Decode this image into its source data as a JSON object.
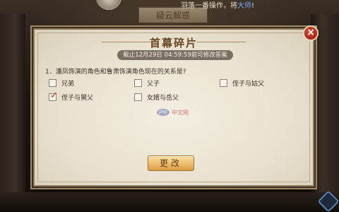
{
  "background": {
    "top_tab_label": "疑云解惑",
    "notice_prefix": "羽落一番操作，将大师",
    "notice_highlight": "大师",
    "notice_suffix": "!"
  },
  "dialog": {
    "title": "首幕碎片",
    "deadline": "截止12月29日 04:59:59前可修改答案",
    "close_icon": "×",
    "question": "1．潘凤饰演的角色和鲁肃饰演角色现在的关系是?",
    "options": [
      {
        "label": "兄弟",
        "checked": false
      },
      {
        "label": "父子",
        "checked": false
      },
      {
        "label": "侄子与姑父",
        "checked": false
      },
      {
        "label": "侄子与舅父",
        "checked": true
      },
      {
        "label": "女婿与岳父",
        "checked": false
      }
    ],
    "submit_label": "更改"
  },
  "watermark": {
    "logo": "php",
    "text": "中文网"
  },
  "colors": {
    "accent_red": "#c2302a",
    "title_brown": "#6a4723",
    "button_gold": "#edbd6a"
  }
}
